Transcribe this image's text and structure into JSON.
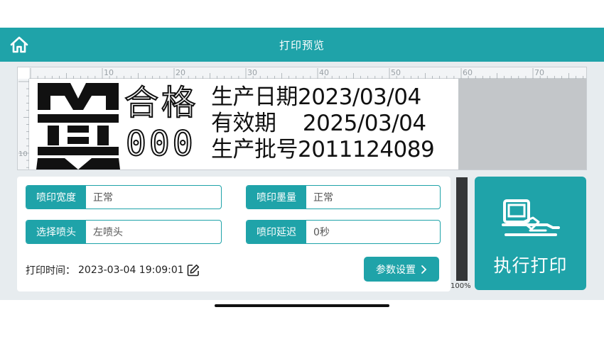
{
  "header": {
    "title": "打印预览",
    "home_icon": "home-icon"
  },
  "preview": {
    "ruler_top_labels": [
      "10",
      "20",
      "30",
      "40",
      "50",
      "60",
      "70"
    ],
    "ruler_left_labels": [
      "10"
    ],
    "dot_chars_row1": "合格",
    "dot_chars_row2": "000",
    "lines": [
      "生产日期2023/03/04",
      "有效期    2025/03/04",
      "生产批号2011124089"
    ]
  },
  "settings": {
    "spray_width": {
      "label": "喷印宽度",
      "value": "正常"
    },
    "ink_amount": {
      "label": "喷印墨量",
      "value": "正常"
    },
    "nozzle": {
      "label": "选择喷头",
      "value": "左喷头"
    },
    "delay": {
      "label": "喷印延迟",
      "value": "0秒"
    },
    "print_time_label": "打印时间：",
    "print_time_value": "2023-03-04 19:09:01",
    "params_button": "参数设置"
  },
  "ink": {
    "label": "100%",
    "level": 1.0
  },
  "execute": {
    "label": "执行打印"
  },
  "colors": {
    "accent": "#1fa3a9",
    "background": "#e7ecef"
  }
}
